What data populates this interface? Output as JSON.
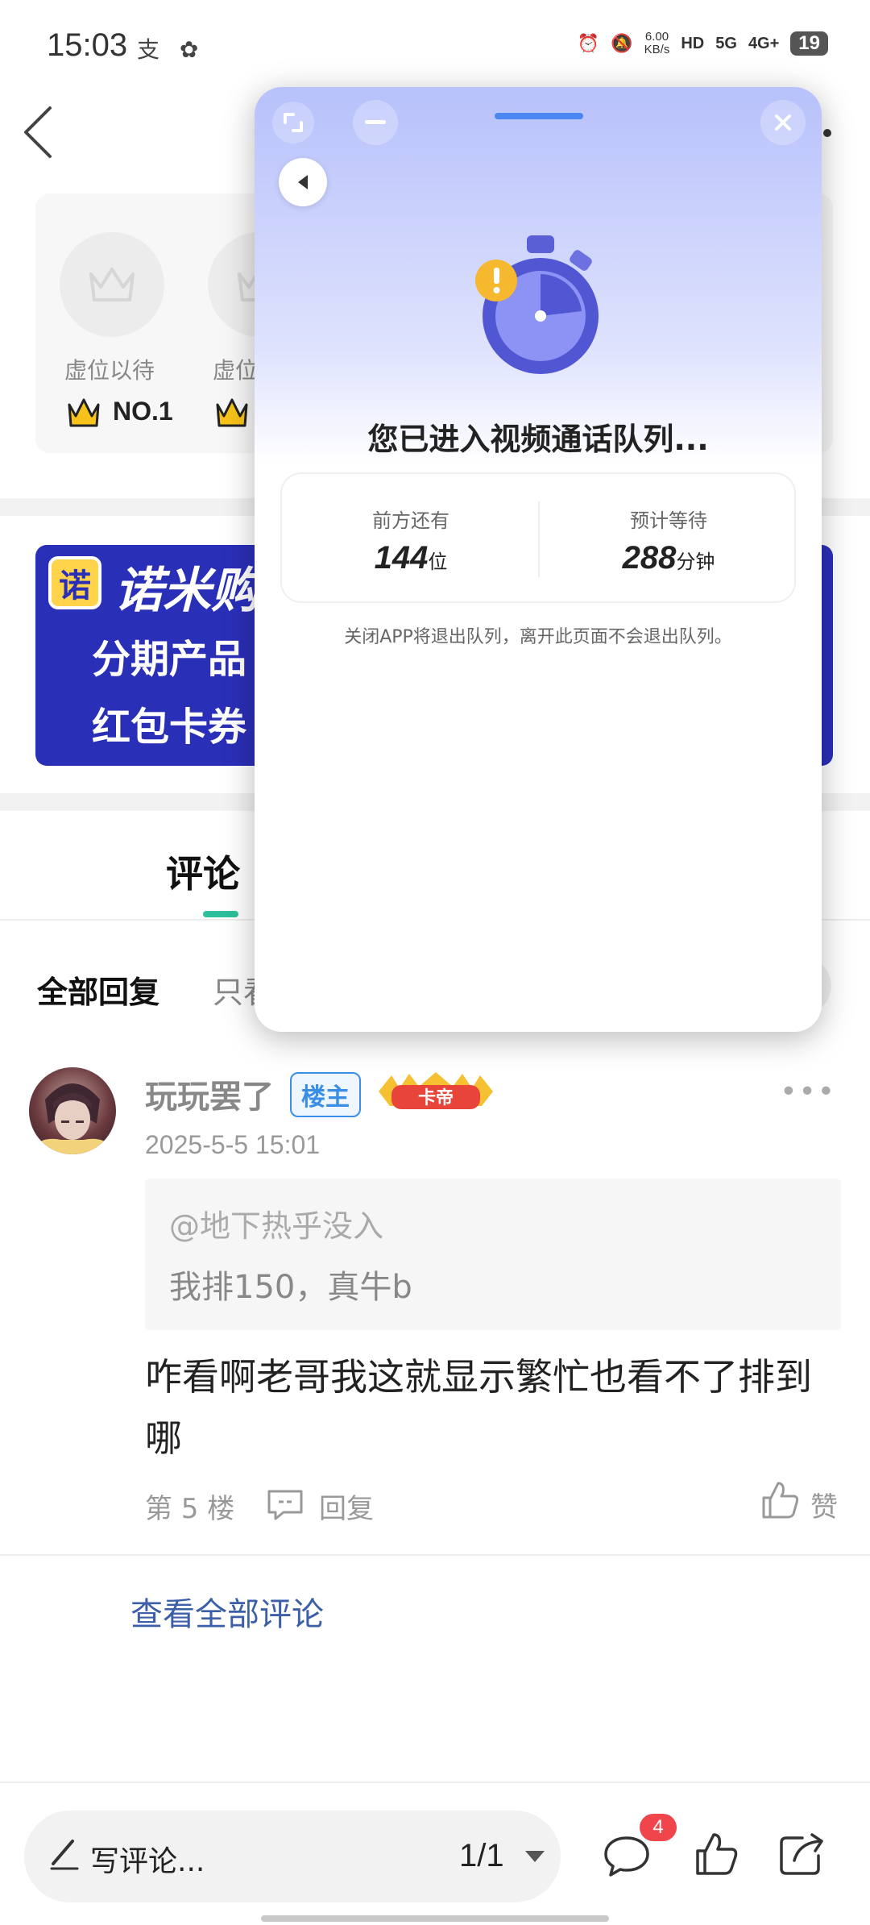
{
  "status_bar": {
    "time": "15:03",
    "left_icons": "支 ✿",
    "speed_top": "6.00",
    "speed_bottom": "KB/s",
    "hd": "HD",
    "net1": "5G",
    "net2": "4G+",
    "battery": "19"
  },
  "rank_card": {
    "items": [
      {
        "label": "虚位以待",
        "rank": "NO.1"
      },
      {
        "label": "虚位",
        "rank": ""
      }
    ]
  },
  "banner": {
    "logo_char": "诺",
    "title": "诺米购·",
    "line1": "分期产品",
    "line2": "红包卡券"
  },
  "tabs": {
    "comment": "评论 ·"
  },
  "filters": {
    "all": "全部回复",
    "only": "只看"
  },
  "comment": {
    "username": "玩玩罢了",
    "owner_badge": "楼主",
    "emperor_badge": "卡帝",
    "more": "•••",
    "timestamp": "2025-5-5 15:01",
    "quote_at": "@地下热乎没入",
    "quote_text": "我排150，真牛b",
    "body": "咋看啊老哥我这就显示繁忙也看不了排到哪",
    "floor": "第 5 楼",
    "reply_label": "回复",
    "like_label": "赞"
  },
  "view_all": "查看全部评论",
  "bottom_bar": {
    "write_label": "写评论...",
    "page_indicator": "1/1",
    "comment_count": "4"
  },
  "queue_panel": {
    "title": "您已进入视频通话队列...",
    "ahead_label": "前方还有",
    "ahead_value": "144",
    "ahead_unit": "位",
    "wait_label": "预计等待",
    "wait_value": "288",
    "wait_unit": "分钟",
    "note": "关闭APP将退出队列，离开此页面不会退出队列。"
  },
  "colors": {
    "accent_green": "#2fbf9a",
    "link_blue": "#3d5fa8",
    "badge_red": "#f0464b",
    "banner_blue": "#2a2fb8",
    "panel_handle": "#4c86f0"
  }
}
